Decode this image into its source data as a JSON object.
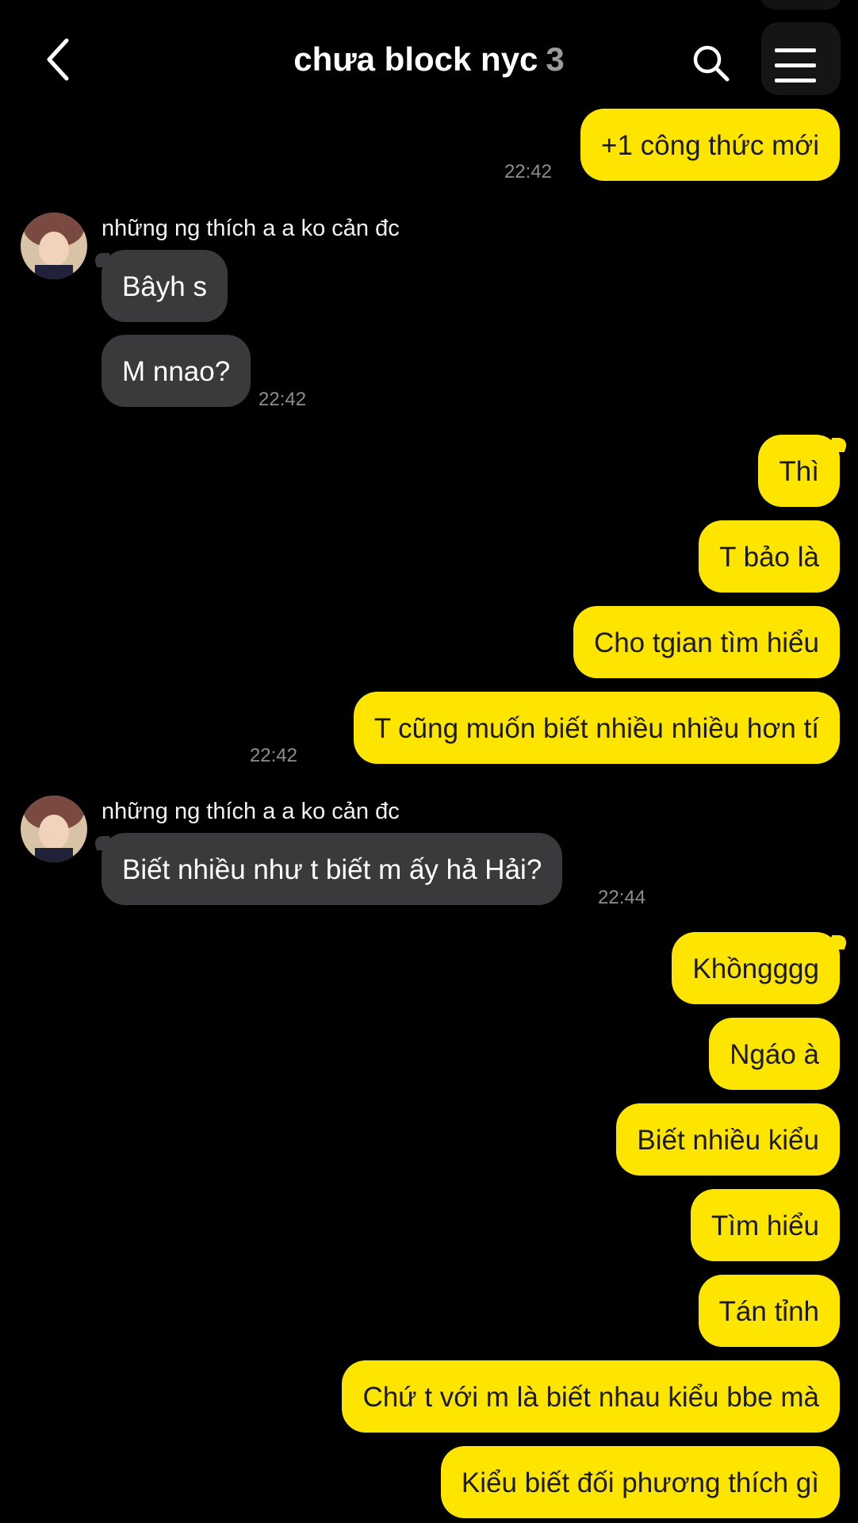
{
  "header": {
    "title": "chưa block nyc",
    "member_count": "3",
    "back_icon": "chevron-left-icon",
    "search_icon": "search-icon",
    "menu_icon": "hamburger-menu-icon"
  },
  "colors": {
    "background": "#000000",
    "outgoing_bubble": "#fee500",
    "incoming_bubble": "#3a3a3c",
    "timestamp": "#8e8e8e"
  },
  "messages": [
    {
      "dir": "out",
      "text": "+1 công thức mới",
      "time": "22:42"
    },
    {
      "dir": "sender",
      "name": "những ng thích a a ko cản đc"
    },
    {
      "dir": "in",
      "text": "Bâyh s"
    },
    {
      "dir": "in",
      "text": "M nnao?",
      "time": "22:42"
    },
    {
      "dir": "out",
      "text": "Thì"
    },
    {
      "dir": "out",
      "text": "T bảo là"
    },
    {
      "dir": "out",
      "text": "Cho tgian tìm hiểu"
    },
    {
      "dir": "out",
      "text": "T cũng muốn biết nhiều nhiều hơn tí",
      "time": "22:42"
    },
    {
      "dir": "sender",
      "name": "những ng thích a a ko cản đc"
    },
    {
      "dir": "in",
      "text": "Biết nhiều như t biết m ấy hả Hải?",
      "time": "22:44"
    },
    {
      "dir": "out",
      "text": "Khồngggg"
    },
    {
      "dir": "out",
      "text": "Ngáo à"
    },
    {
      "dir": "out",
      "text": "Biết nhiều kiểu"
    },
    {
      "dir": "out",
      "text": "Tìm hiểu"
    },
    {
      "dir": "out",
      "text": "Tán tỉnh"
    },
    {
      "dir": "out",
      "text": "Chứ t với m là biết nhau kiểu bbe mà"
    },
    {
      "dir": "out",
      "text": "Kiểu biết đối phương thích gì"
    }
  ]
}
